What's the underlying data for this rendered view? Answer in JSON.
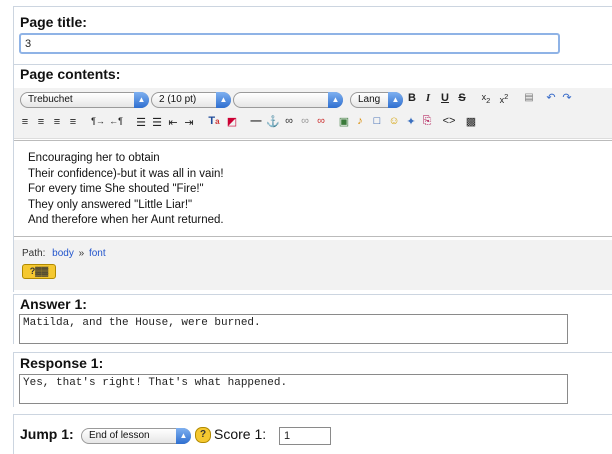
{
  "page_title": {
    "label": "Page title:",
    "value": "3"
  },
  "page_contents": {
    "label": "Page contents:",
    "font_family": "Trebuchet",
    "font_size": "2 (10 pt)",
    "format_value": "",
    "lang_label": "Lang",
    "lines": [
      "Encouraging her to obtain",
      "Their confidence)-but it was all in vain!",
      "For every time She shouted \"Fire!\"",
      "They only answered \"Little Liar!\"",
      "And therefore when her Aunt returned."
    ],
    "path_label": "Path:",
    "path_body": "body",
    "path_sep": "»",
    "path_font": "font"
  },
  "answer1": {
    "label": "Answer 1:",
    "value": "Matilda, and the House, were burned."
  },
  "response1": {
    "label": "Response 1:",
    "value": "Yes, that's right! That's what happened."
  },
  "jump1": {
    "label": "Jump 1:",
    "selected": "End of lesson",
    "score_label": "Score 1:",
    "score_value": "1"
  }
}
